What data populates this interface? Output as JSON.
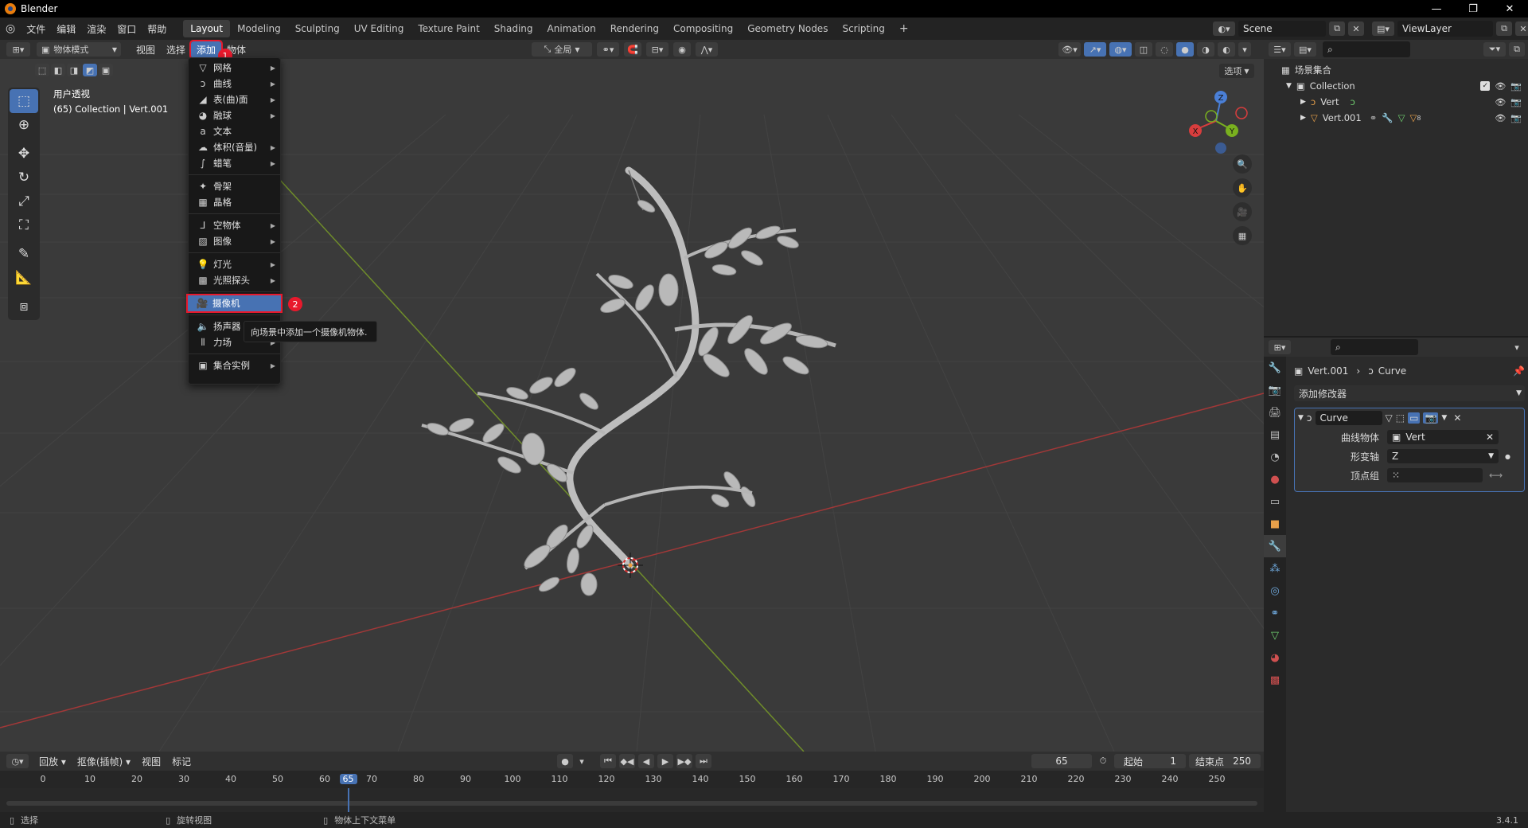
{
  "app": {
    "title": "Blender",
    "version": "3.4.1"
  },
  "topmenu": [
    "文件",
    "编辑",
    "渲染",
    "窗口",
    "帮助"
  ],
  "workspaces": [
    {
      "label": "Layout",
      "active": true
    },
    {
      "label": "Modeling"
    },
    {
      "label": "Sculpting"
    },
    {
      "label": "UV Editing"
    },
    {
      "label": "Texture Paint"
    },
    {
      "label": "Shading"
    },
    {
      "label": "Animation"
    },
    {
      "label": "Rendering"
    },
    {
      "label": "Compositing"
    },
    {
      "label": "Geometry Nodes"
    },
    {
      "label": "Scripting"
    }
  ],
  "scene": {
    "name": "Scene",
    "view_layer": "ViewLayer"
  },
  "viewport_header": {
    "mode": "物体模式",
    "menus": [
      "视图",
      "选择",
      "添加",
      "物体"
    ],
    "orientation": "全局",
    "options": "选项"
  },
  "viewport": {
    "info_title": "用户透视",
    "info_sub": "(65) Collection | Vert.001",
    "gizmo": {
      "x": "X",
      "y": "Y",
      "z": "Z"
    }
  },
  "add_menu": {
    "items": [
      {
        "label": "网格",
        "icon": "mesh-icon",
        "submenu": true
      },
      {
        "label": "曲线",
        "icon": "curve-icon",
        "submenu": true
      },
      {
        "label": "表(曲)面",
        "icon": "surface-icon",
        "submenu": true
      },
      {
        "label": "融球",
        "icon": "metaball-icon",
        "submenu": true
      },
      {
        "label": "文本",
        "icon": "text-icon",
        "submenu": false
      },
      {
        "label": "体积(音量)",
        "icon": "volume-icon",
        "submenu": true
      },
      {
        "label": "蜡笔",
        "icon": "grease-pencil-icon",
        "submenu": true
      },
      {
        "sep": true
      },
      {
        "label": "骨架",
        "icon": "armature-icon",
        "submenu": false
      },
      {
        "label": "晶格",
        "icon": "lattice-icon",
        "submenu": false
      },
      {
        "sep": true
      },
      {
        "label": "空物体",
        "icon": "empty-icon",
        "submenu": true
      },
      {
        "label": "图像",
        "icon": "image-icon",
        "submenu": true
      },
      {
        "sep": true
      },
      {
        "label": "灯光",
        "icon": "light-icon",
        "submenu": true
      },
      {
        "label": "光照探头",
        "icon": "light-probe-icon",
        "submenu": true
      },
      {
        "sep": true
      },
      {
        "label": "摄像机",
        "icon": "camera-icon",
        "submenu": false,
        "selected": true
      },
      {
        "sep": true
      },
      {
        "label": "扬声器",
        "icon": "speaker-icon",
        "submenu": false
      },
      {
        "label": "力场",
        "icon": "force-field-icon",
        "submenu": true
      },
      {
        "sep": true
      },
      {
        "label": "集合实例",
        "icon": "collection-instance-icon",
        "submenu": true
      }
    ],
    "tooltip": "向场景中添加一个摄像机物体."
  },
  "annotations": {
    "step1": "1",
    "step2": "2"
  },
  "outliner": {
    "root": "场景集合",
    "collection": "Collection",
    "objects": [
      {
        "name": "Vert",
        "icon": "curve-icon"
      },
      {
        "name": "Vert.001",
        "icon": "mesh-object-icon",
        "badge": "8"
      }
    ]
  },
  "properties": {
    "breadcrumb_object": "Vert.001",
    "breadcrumb_modifier": "Curve",
    "add_modifier": "添加修改器",
    "modifier": {
      "name": "Curve",
      "fields": [
        {
          "label": "曲线物体",
          "value": "Vert"
        },
        {
          "label": "形变轴",
          "value": "Z"
        },
        {
          "label": "顶点组",
          "value": ""
        }
      ]
    }
  },
  "timeline": {
    "menus": [
      "回放",
      "抠像(插帧)",
      "视图",
      "标记"
    ],
    "current_frame": "65",
    "start_label": "起始",
    "start": "1",
    "end_label": "结束点",
    "end": "250",
    "ticks": [
      "0",
      "10",
      "20",
      "30",
      "40",
      "50",
      "60",
      "65",
      "70",
      "80",
      "90",
      "100",
      "110",
      "120",
      "130",
      "140",
      "150",
      "160",
      "170",
      "180",
      "190",
      "200",
      "210",
      "220",
      "230",
      "240",
      "250"
    ]
  },
  "statusbar": {
    "select": "选择",
    "rotate": "旋转视图",
    "context": "物体上下文菜单"
  },
  "colors": {
    "accent": "#4772b3",
    "annotation": "#e8192c",
    "x_axis": "#b03a3a",
    "y_axis": "#6b8e23"
  }
}
